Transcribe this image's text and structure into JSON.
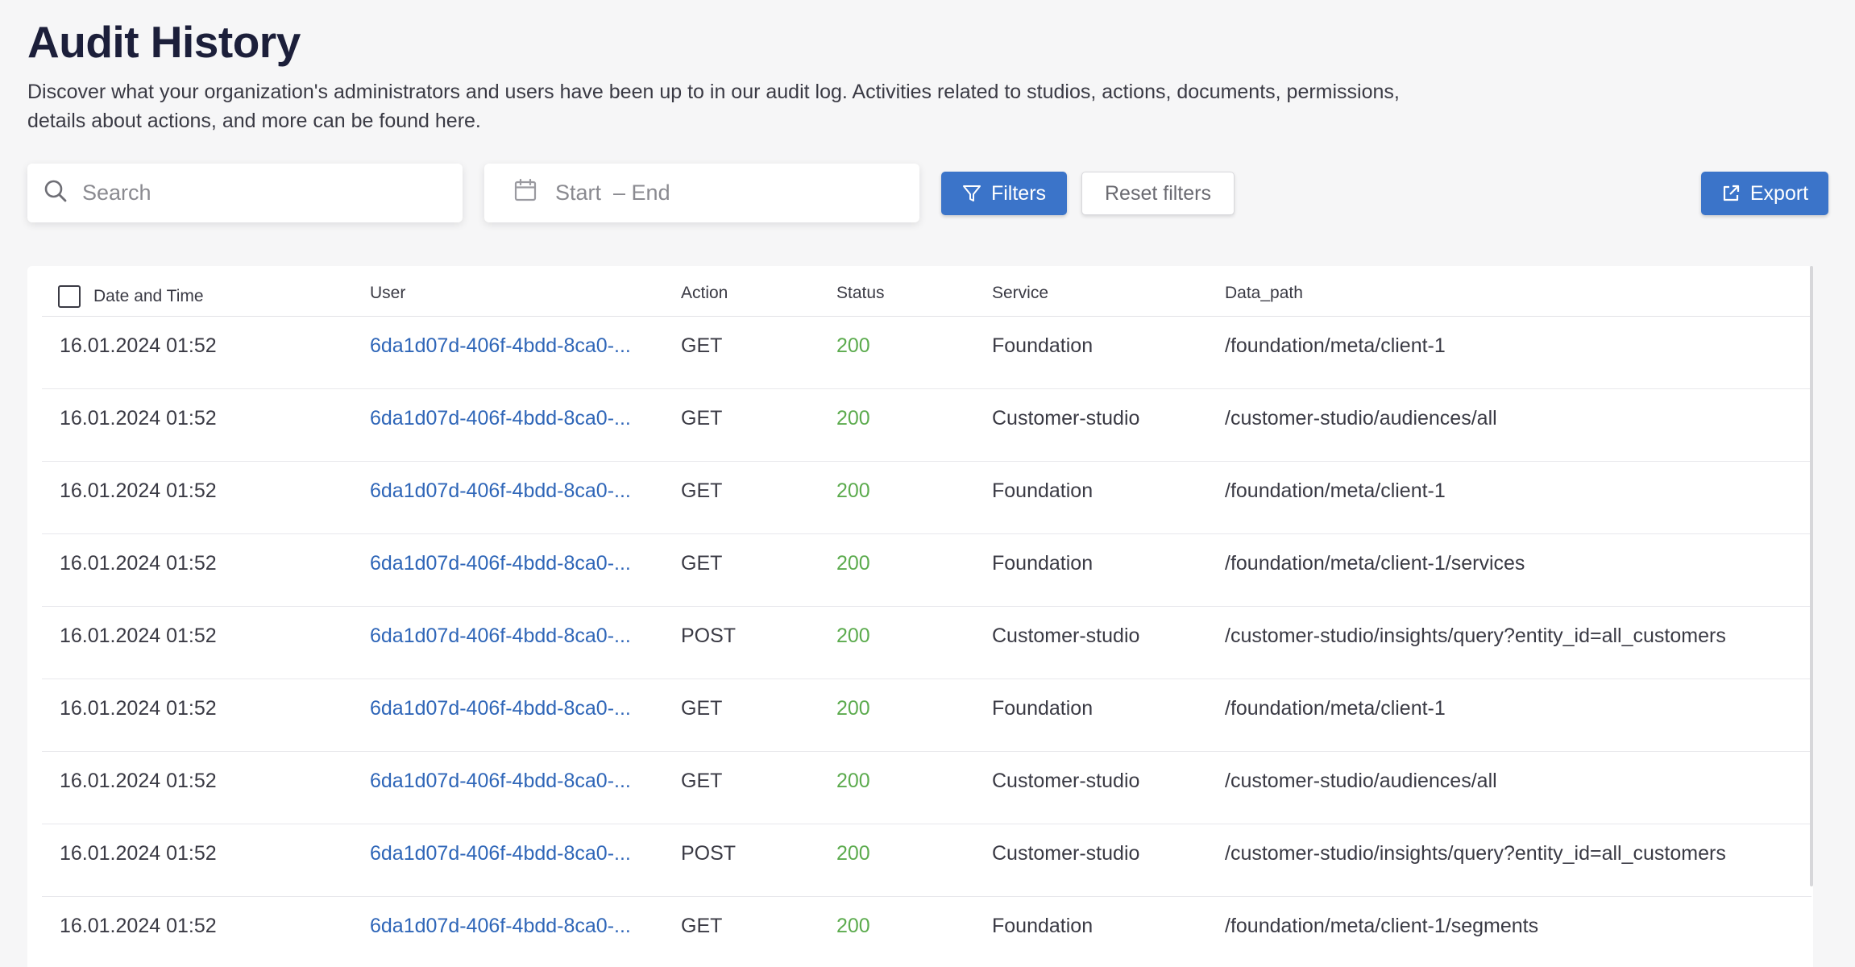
{
  "header": {
    "title": "Audit History",
    "description": "Discover what your organization's administrators and users have been up to in our audit log. Activities related to studios, actions, documents, permissions, details about actions, and more can be found here."
  },
  "toolbar": {
    "search_placeholder": "Search",
    "date_range": "Start  – End",
    "filters_label": "Filters",
    "reset_label": "Reset filters",
    "export_label": "Export"
  },
  "table": {
    "columns": [
      "Date and Time",
      "User",
      "Action",
      "Status",
      "Service",
      "Data_path"
    ],
    "rows": [
      {
        "date": "16.01.2024 01:52",
        "user": "6da1d07d-406f-4bdd-8ca0-...",
        "action": "GET",
        "status": "200",
        "service": "Foundation",
        "path": "/foundation/meta/client-1"
      },
      {
        "date": "16.01.2024 01:52",
        "user": "6da1d07d-406f-4bdd-8ca0-...",
        "action": "GET",
        "status": "200",
        "service": "Customer-studio",
        "path": "/customer-studio/audiences/all"
      },
      {
        "date": "16.01.2024 01:52",
        "user": "6da1d07d-406f-4bdd-8ca0-...",
        "action": "GET",
        "status": "200",
        "service": "Foundation",
        "path": "/foundation/meta/client-1"
      },
      {
        "date": "16.01.2024 01:52",
        "user": "6da1d07d-406f-4bdd-8ca0-...",
        "action": "GET",
        "status": "200",
        "service": "Foundation",
        "path": "/foundation/meta/client-1/services"
      },
      {
        "date": "16.01.2024 01:52",
        "user": "6da1d07d-406f-4bdd-8ca0-...",
        "action": "POST",
        "status": "200",
        "service": "Customer-studio",
        "path": "/customer-studio/insights/query?entity_id=all_customers"
      },
      {
        "date": "16.01.2024 01:52",
        "user": "6da1d07d-406f-4bdd-8ca0-...",
        "action": "GET",
        "status": "200",
        "service": "Foundation",
        "path": "/foundation/meta/client-1"
      },
      {
        "date": "16.01.2024 01:52",
        "user": "6da1d07d-406f-4bdd-8ca0-...",
        "action": "GET",
        "status": "200",
        "service": "Customer-studio",
        "path": "/customer-studio/audiences/all"
      },
      {
        "date": "16.01.2024 01:52",
        "user": "6da1d07d-406f-4bdd-8ca0-...",
        "action": "POST",
        "status": "200",
        "service": "Customer-studio",
        "path": "/customer-studio/insights/query?entity_id=all_customers"
      },
      {
        "date": "16.01.2024 01:52",
        "user": "6da1d07d-406f-4bdd-8ca0-...",
        "action": "GET",
        "status": "200",
        "service": "Foundation",
        "path": "/foundation/meta/client-1/segments"
      }
    ]
  },
  "icons": {
    "search": "search-icon",
    "calendar": "calendar-icon",
    "filter": "filter-icon",
    "export": "external-link-icon"
  },
  "colors": {
    "primary": "#3b74c9",
    "link": "#2f66b8",
    "status_ok": "#5cab4e",
    "title": "#1c1f3a"
  }
}
